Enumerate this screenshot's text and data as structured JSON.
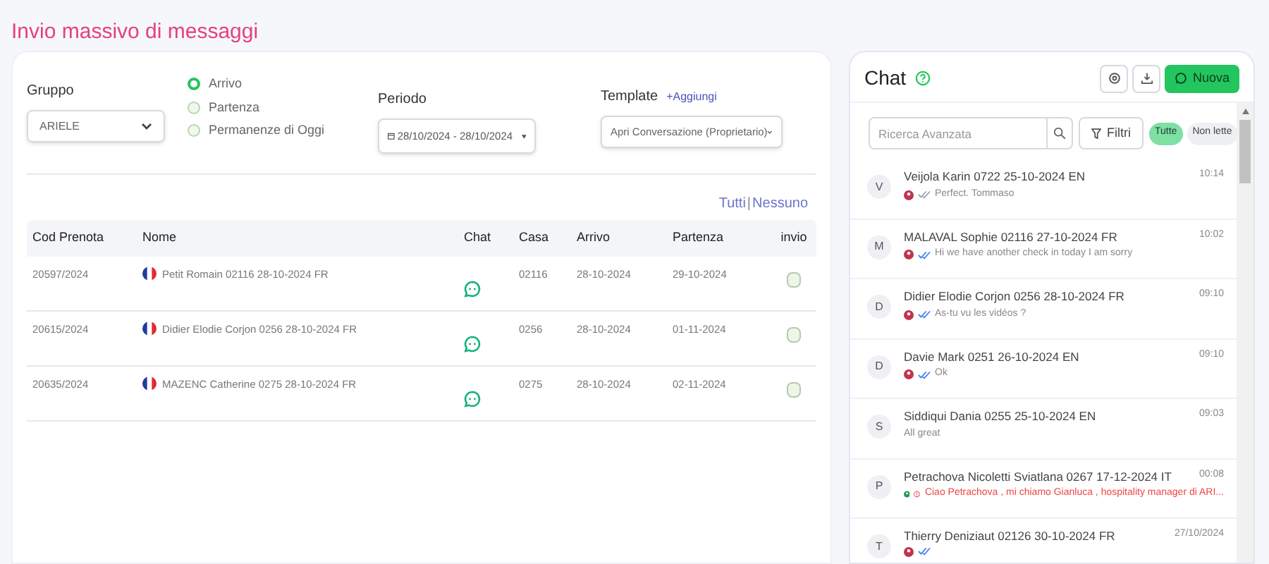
{
  "page_title": "Invio massivo di messaggi",
  "filters": {
    "group_label": "Gruppo",
    "group_value": "ARIELE",
    "radios": [
      {
        "label": "Arrivo",
        "selected": true
      },
      {
        "label": "Partenza",
        "selected": false
      },
      {
        "label": "Permanenze di Oggi",
        "selected": false
      }
    ],
    "period_label": "Periodo",
    "period_value": "28/10/2024 - 28/10/2024",
    "template_label": "Template",
    "template_add": "+Aggiungi",
    "template_value": "Apri Conversazione (Proprietario)"
  },
  "select_all": "Tutti",
  "select_separator": "|",
  "select_none": "Nessuno",
  "table": {
    "columns": [
      "Cod Prenota",
      "Nome",
      "Chat",
      "Casa",
      "Arrivo",
      "Partenza",
      "invio"
    ],
    "rows": [
      {
        "code": "20597/2024",
        "name": "Petit Romain 02116 28-10-2024 FR",
        "house": "02116",
        "arrival": "28-10-2024",
        "departure": "29-10-2024",
        "checked": false
      },
      {
        "code": "20615/2024",
        "name": "Didier Elodie Corjon 0256 28-10-2024 FR",
        "house": "0256",
        "arrival": "28-10-2024",
        "departure": "01-11-2024",
        "checked": false
      },
      {
        "code": "20635/2024",
        "name": "MAZENC Catherine 0275 28-10-2024 FR",
        "house": "0275",
        "arrival": "28-10-2024",
        "departure": "02-11-2024",
        "checked": false
      }
    ]
  },
  "chat": {
    "title": "Chat",
    "new_button": "Nuova",
    "search_placeholder": "Ricerca Avanzata",
    "filter_button": "Filtri",
    "tabs": [
      {
        "label": "Tutte",
        "selected": true
      },
      {
        "label": "Non lette",
        "selected": false
      }
    ],
    "items": [
      {
        "initial": "V",
        "name": "Veijola Karin 0722 25-10-2024 EN",
        "time": "10:14",
        "kind": "sent",
        "read": false,
        "message": "Perfect. Tommaso"
      },
      {
        "initial": "M",
        "name": "MALAVAL Sophie 02116 27-10-2024 FR",
        "time": "10:02",
        "kind": "sent",
        "read": true,
        "message": "Hi we have another check in today I am sorry"
      },
      {
        "initial": "D",
        "name": "Didier Elodie Corjon 0256 28-10-2024 FR",
        "time": "09:10",
        "kind": "sent",
        "read": true,
        "message": "As-tu vu les vidéos ?"
      },
      {
        "initial": "D",
        "name": "Davie Mark 0251 26-10-2024 EN",
        "time": "09:10",
        "kind": "sent",
        "read": true,
        "message": "Ok"
      },
      {
        "initial": "S",
        "name": "Siddiqui Dania 0255 25-10-2024 EN",
        "time": "09:03",
        "kind": "received",
        "message": "All great"
      },
      {
        "initial": "P",
        "name": "Petrachova Nicoletti Sviatlana 0267 17-12-2024 IT",
        "time": "00:08",
        "kind": "error",
        "message": "Ciao Petrachova , mi chiamo Gianluca , hospitality manager di ARI..."
      },
      {
        "initial": "T",
        "name": "Thierry Deniziaut 02126 30-10-2024 FR",
        "time": "27/10/2024",
        "kind": "sent",
        "read": true
      }
    ]
  }
}
